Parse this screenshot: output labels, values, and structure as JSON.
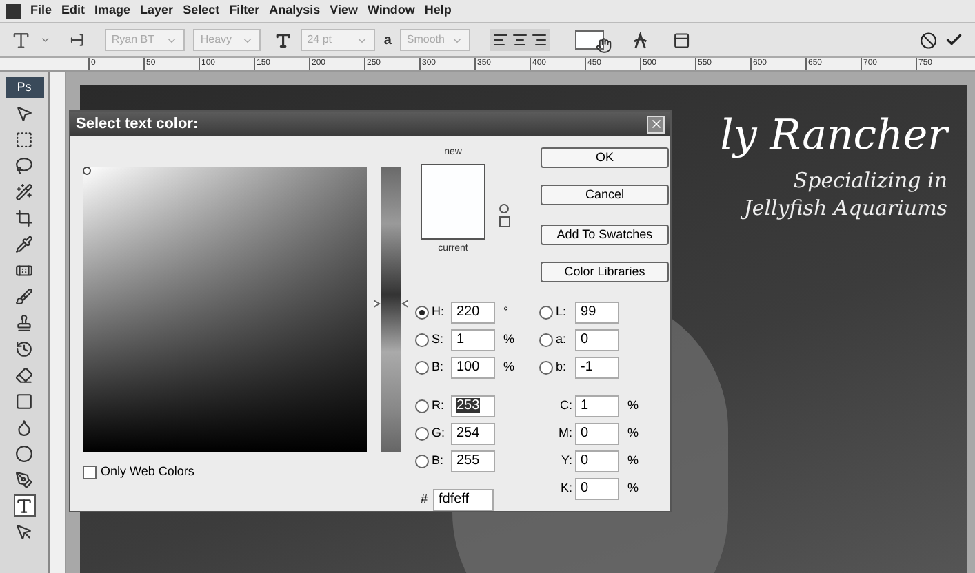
{
  "menu": [
    "File",
    "Edit",
    "Image",
    "Layer",
    "Select",
    "Filter",
    "Analysis",
    "View",
    "Window",
    "Help"
  ],
  "options_bar": {
    "font_family": "Ryan BT",
    "font_style": "Heavy",
    "font_size": "24 pt",
    "anti_alias_label": "a",
    "anti_alias": "Smooth"
  },
  "ruler_ticks": [
    "0",
    "50",
    "100",
    "150",
    "200",
    "250",
    "300",
    "350",
    "400",
    "450",
    "500",
    "550",
    "600",
    "650",
    "700",
    "750"
  ],
  "toolbox": {
    "logo": "Ps",
    "tools": [
      {
        "kind": "move",
        "selected": false
      },
      {
        "kind": "marquee",
        "selected": false
      },
      {
        "kind": "lasso",
        "selected": false
      },
      {
        "kind": "wand",
        "selected": false
      },
      {
        "kind": "crop",
        "selected": false
      },
      {
        "kind": "eyedropper",
        "selected": false
      },
      {
        "kind": "heal",
        "selected": false
      },
      {
        "kind": "brush",
        "selected": false
      },
      {
        "kind": "stamp",
        "selected": false
      },
      {
        "kind": "history",
        "selected": false
      },
      {
        "kind": "eraser",
        "selected": false
      },
      {
        "kind": "gradient",
        "selected": false
      },
      {
        "kind": "blur",
        "selected": false
      },
      {
        "kind": "dodge",
        "selected": false
      },
      {
        "kind": "pen",
        "selected": false
      },
      {
        "kind": "type",
        "selected": true
      },
      {
        "kind": "select",
        "selected": false
      }
    ]
  },
  "canvas": {
    "heading": "ly Rancher",
    "tagline_lines": [
      "Specializing in",
      "Jellyfish Aquariums"
    ]
  },
  "dialog": {
    "title": "Select text color:",
    "hue_slider": {
      "level": 0.52
    },
    "new_label": "new",
    "current_label": "current",
    "buttons": [
      "OK",
      "Cancel",
      "Add To Swatches",
      "Color Libraries"
    ],
    "only_web_colors": {
      "label": "Only Web Colors",
      "checked": false
    },
    "hsb": [
      {
        "label": "H:",
        "value": "220",
        "unit": "°",
        "selected": true
      },
      {
        "label": "S:",
        "value": "1",
        "unit": "%",
        "selected": false
      },
      {
        "label": "B:",
        "value": "100",
        "unit": "%",
        "selected": false
      }
    ],
    "lab": [
      {
        "label": "L:",
        "value": "99",
        "selected": false
      },
      {
        "label": "a:",
        "value": "0",
        "selected": false
      },
      {
        "label": "b:",
        "value": "-1",
        "selected": false
      }
    ],
    "rgb": [
      {
        "label": "R:",
        "value": "253",
        "selected": false,
        "highlighted": true
      },
      {
        "label": "G:",
        "value": "254",
        "selected": false,
        "highlighted": false
      },
      {
        "label": "B:",
        "value": "255",
        "selected": false,
        "highlighted": false
      }
    ],
    "cmyk": [
      {
        "label": "C:",
        "value": "1",
        "unit": "%"
      },
      {
        "label": "M:",
        "value": "0",
        "unit": "%"
      },
      {
        "label": "Y:",
        "value": "0",
        "unit": "%"
      },
      {
        "label": "K:",
        "value": "0",
        "unit": "%"
      }
    ],
    "hex": {
      "label": "#",
      "value": "fdfeff"
    }
  }
}
